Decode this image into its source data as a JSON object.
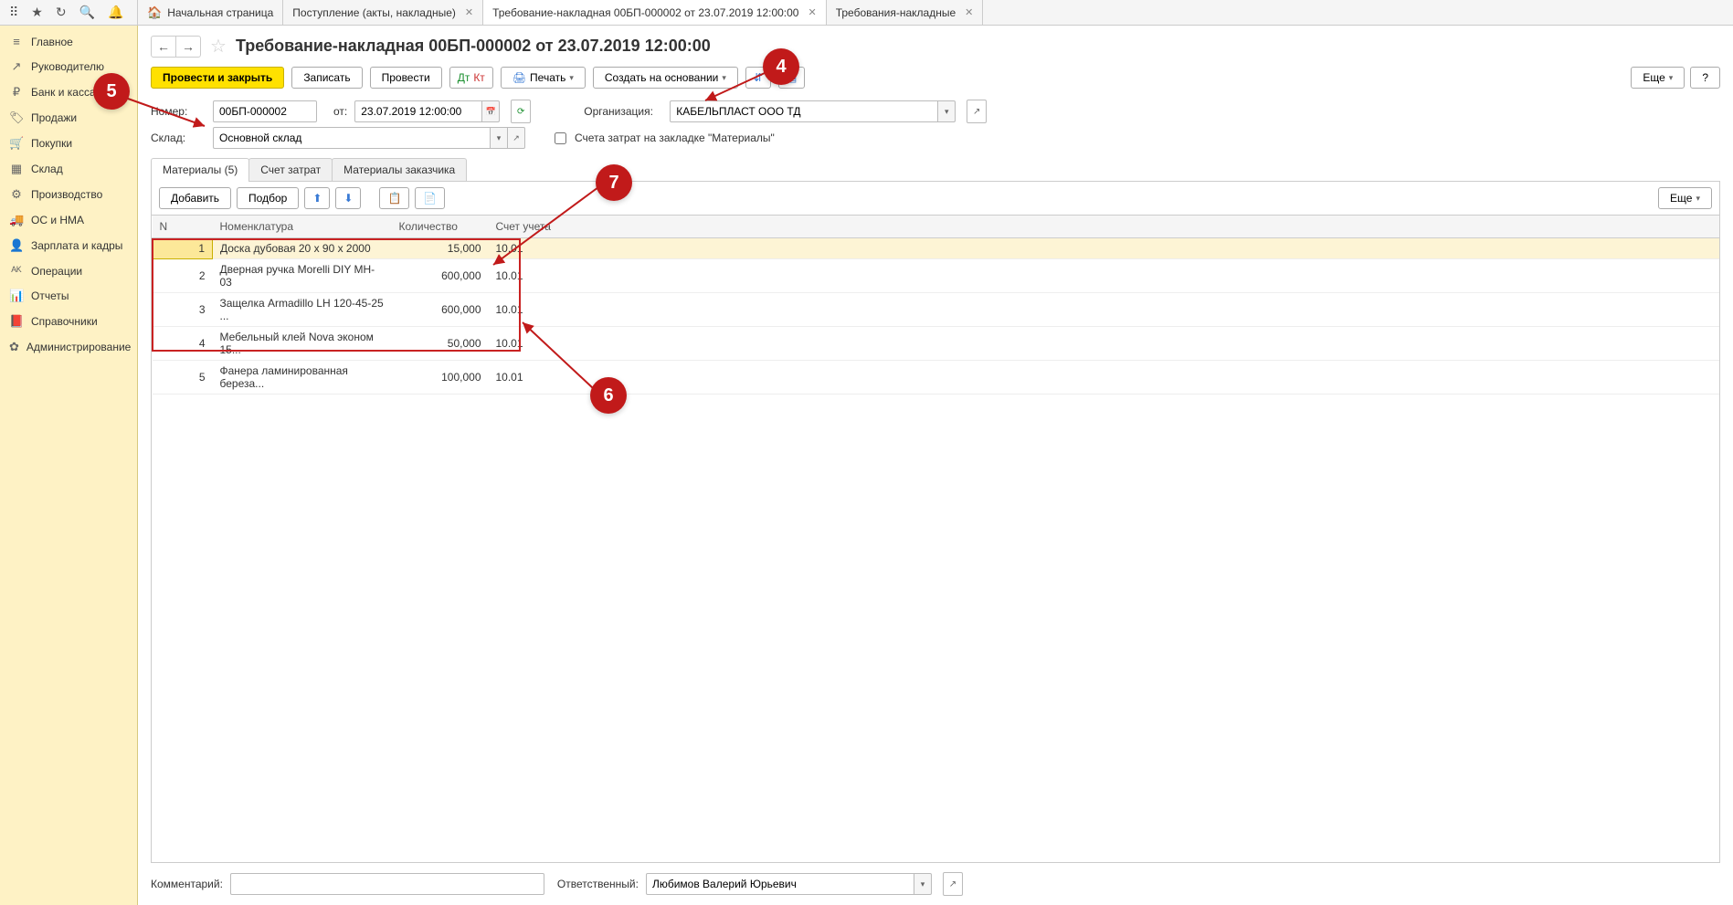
{
  "topbar": {
    "tabs": [
      {
        "label": "Начальная страница",
        "hasHome": true
      },
      {
        "label": "Поступление (акты, накладные)",
        "closable": true
      },
      {
        "label": "Требование-накладная 00БП-000002 от 23.07.2019 12:00:00",
        "closable": true,
        "active": true
      },
      {
        "label": "Требования-накладные",
        "closable": true
      }
    ]
  },
  "sidebar": {
    "items": [
      {
        "label": "Главное",
        "icon": "≡"
      },
      {
        "label": "Руководителю",
        "icon": "↗"
      },
      {
        "label": "Банк и касса",
        "icon": "₽"
      },
      {
        "label": "Продажи",
        "icon": "🏷"
      },
      {
        "label": "Покупки",
        "icon": "🛒"
      },
      {
        "label": "Склад",
        "icon": "▦"
      },
      {
        "label": "Производство",
        "icon": "⚙"
      },
      {
        "label": "ОС и НМА",
        "icon": "🚚"
      },
      {
        "label": "Зарплата и кадры",
        "icon": "👤"
      },
      {
        "label": "Операции",
        "icon": "ᴬᴷ"
      },
      {
        "label": "Отчеты",
        "icon": "📊"
      },
      {
        "label": "Справочники",
        "icon": "📕"
      },
      {
        "label": "Администрирование",
        "icon": "✿"
      }
    ]
  },
  "header": {
    "title": "Требование-накладная 00БП-000002 от 23.07.2019 12:00:00"
  },
  "toolbar": {
    "post_close": "Провести и закрыть",
    "save": "Записать",
    "post": "Провести",
    "print": "Печать",
    "create_based": "Создать на основании",
    "more": "Еще",
    "help": "?"
  },
  "form": {
    "number_label": "Номер:",
    "number": "00БП-000002",
    "date_label": "от:",
    "date": "23.07.2019 12:00:00",
    "org_label": "Организация:",
    "org": "КАБЕЛЬПЛАСТ ООО ТД",
    "warehouse_label": "Склад:",
    "warehouse": "Основной склад",
    "cost_checkbox_label": "Счета затрат на закладке \"Материалы\""
  },
  "doc_tabs": {
    "materials": "Материалы (5)",
    "cost_acct": "Счет затрат",
    "cust_materials": "Материалы заказчика"
  },
  "table_toolbar": {
    "add": "Добавить",
    "pick": "Подбор",
    "more": "Еще"
  },
  "table": {
    "headers": {
      "n": "N",
      "name": "Номенклатура",
      "qty": "Количество",
      "acct": "Счет учета"
    },
    "rows": [
      {
        "n": "1",
        "name": "Доска дубовая 20 x 90 x 2000",
        "qty": "15,000",
        "acct": "10.01"
      },
      {
        "n": "2",
        "name": "Дверная ручка Morelli DIY MH-03",
        "qty": "600,000",
        "acct": "10.01"
      },
      {
        "n": "3",
        "name": "Защелка Armadillo LH 120-45-25 ...",
        "qty": "600,000",
        "acct": "10.01"
      },
      {
        "n": "4",
        "name": "Мебельный клей Nova эконом 15...",
        "qty": "50,000",
        "acct": "10.01"
      },
      {
        "n": "5",
        "name": "Фанера ламинированная береза...",
        "qty": "100,000",
        "acct": "10.01"
      }
    ]
  },
  "footer": {
    "comment_label": "Комментарий:",
    "responsible_label": "Ответственный:",
    "responsible": "Любимов Валерий Юрьевич"
  },
  "callouts": {
    "c4": "4",
    "c5": "5",
    "c6": "6",
    "c7": "7"
  }
}
